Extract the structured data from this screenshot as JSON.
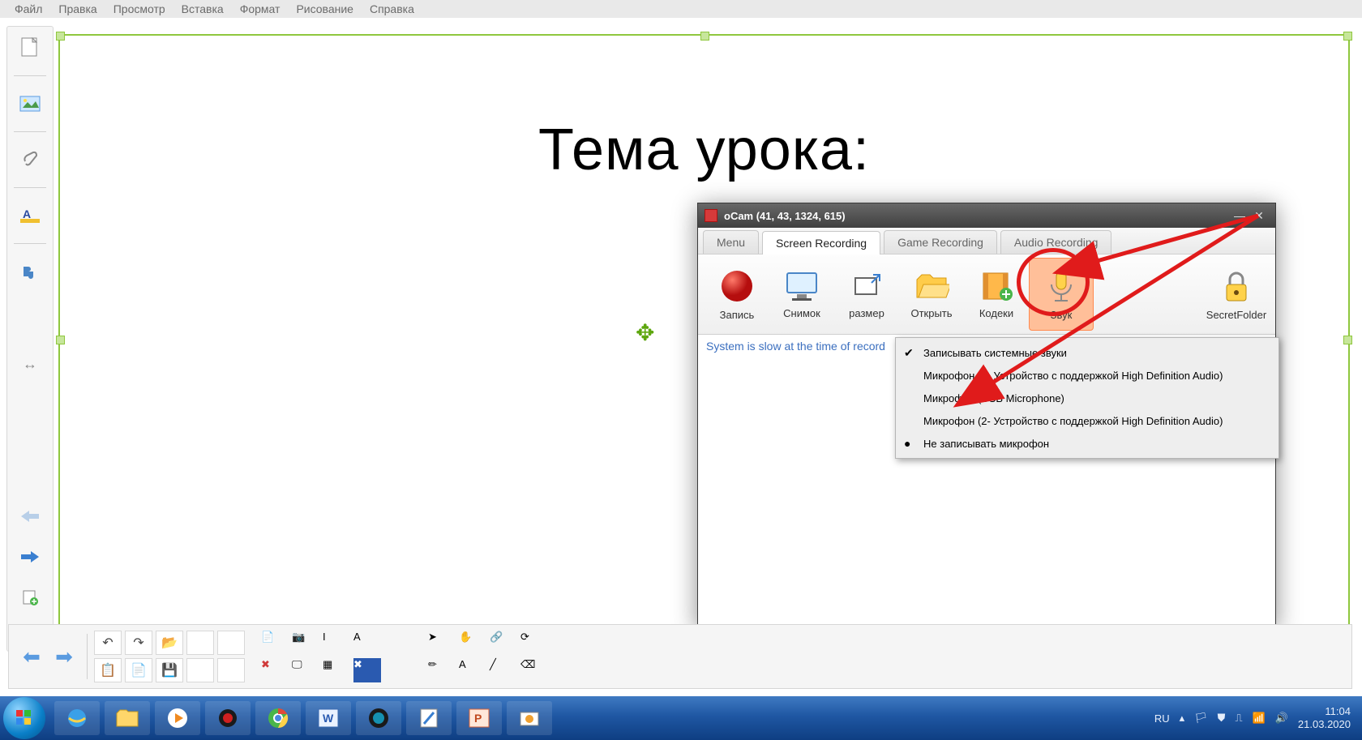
{
  "menubar": [
    "Файл",
    "Правка",
    "Просмотр",
    "Вставка",
    "Формат",
    "Рисование",
    "Справка"
  ],
  "slide": {
    "title": "Тема урока:"
  },
  "ocam": {
    "title": "oCam (41, 43, 1324, 615)",
    "tabs": {
      "menu": "Menu",
      "screen": "Screen Recording",
      "game": "Game Recording",
      "audio": "Audio Recording"
    },
    "toolbar": {
      "record": "Запись",
      "snapshot": "Снимок",
      "resize": "размер",
      "open": "Открыть",
      "codecs": "Кодеки",
      "sound": "Звук",
      "secret": "SecretFolder"
    },
    "status": "System is slow at the time of record"
  },
  "sound_menu": {
    "items": [
      {
        "label": "Записывать системные звуки",
        "mark": "✔"
      },
      {
        "label": "Микрофон (2- Устройство с поддержкой High Definition Audio)",
        "mark": ""
      },
      {
        "label": "Микрофон (USB Microphone)",
        "mark": ""
      },
      {
        "label": "Микрофон (2- Устройство с поддержкой High Definition Audio)",
        "mark": ""
      },
      {
        "label": "Не записывать микрофон",
        "mark": "●"
      }
    ]
  },
  "taskbar": {
    "lang": "RU",
    "time": "11:04",
    "date": "21.03.2020"
  }
}
